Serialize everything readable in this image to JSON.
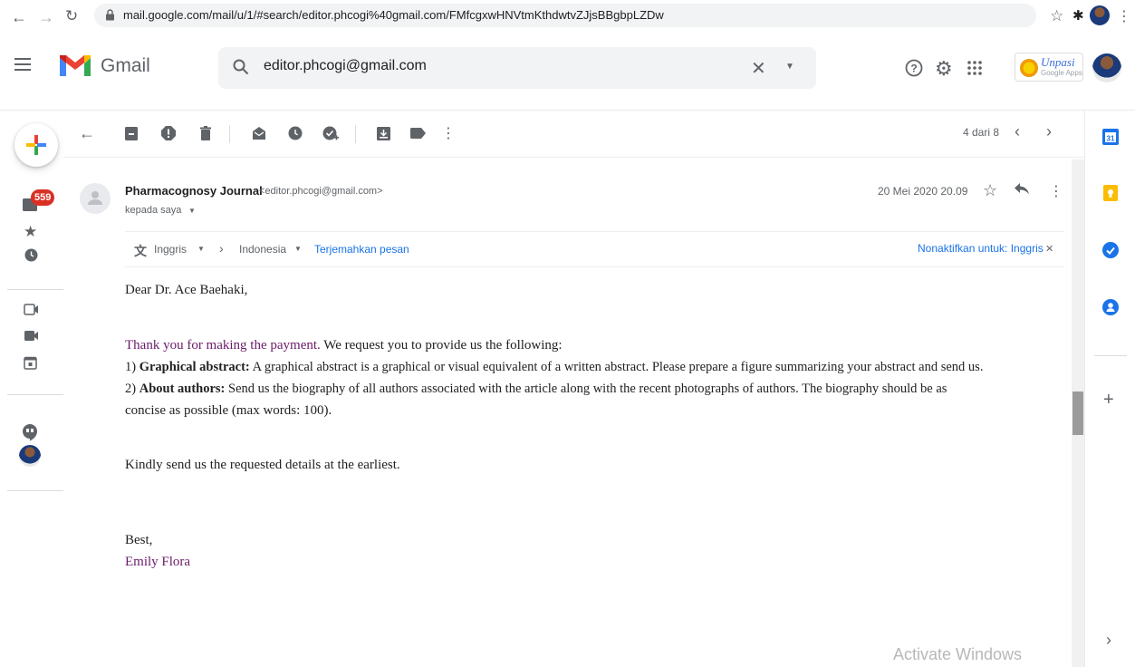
{
  "browser": {
    "url": "mail.google.com/mail/u/1/#search/editor.phcogi%40gmail.com/FMfcgxwHNVtmKthdwtvZJjsBBgbpLZDw"
  },
  "header": {
    "app_name": "Gmail",
    "search_value": "editor.phcogi@gmail.com",
    "workspace_badge": "Unpasi",
    "workspace_sub": "Google Apps"
  },
  "sidebar": {
    "inbox_count": "559"
  },
  "toolbar": {
    "pagination": "4 dari 8"
  },
  "message": {
    "sender_name": "Pharmacognosy Journal",
    "sender_email": "<editor.phcogi@gmail.com>",
    "recipient": "kepada saya",
    "date": "20 Mei 2020 20.09",
    "translate": {
      "from_lang": "Inggris",
      "to_lang": "Indonesia",
      "translate_link": "Terjemahkan pesan",
      "disable_link": "Nonaktifkan untuk: Inggris"
    },
    "greeting": "Dear Dr.  Ace Baehaki,",
    "thanks": "Thank you for making the payment.",
    "request": " We request you to provide us the  following:",
    "item1_num": "1) ",
    "item1_bold": "Graphical abstract:",
    "item1_text": " A graphical abstract is a graphical or visual equivalent of  a written abstract. Please prepare a figure summarizing your abstract and send us.",
    "item2_num": "2) ",
    "item2_bold": "About authors:",
    "item2_text": " Send us the biography of all authors associated with the article along with the recent photographs of authors. The biography should be as",
    "item2_cont": "concise as possible (max words: 100).",
    "closing_request": "Kindly send us the requested details at the earliest.",
    "signoff": "Best,",
    "signature": "Emily Flora"
  },
  "watermark": "Activate Windows",
  "colors": {
    "accent_blue": "#1a73e8",
    "badge_red": "#d93025",
    "signature_purple": "#6a1b6a"
  }
}
